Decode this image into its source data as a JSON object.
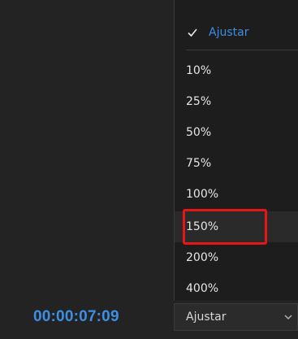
{
  "menu": {
    "selected": "Ajustar",
    "items": [
      "10%",
      "25%",
      "50%",
      "75%",
      "100%",
      "150%",
      "200%",
      "400%"
    ],
    "highlighted_item": "150%"
  },
  "footer": {
    "timecode": "00:00:07:09",
    "zoom_select_value": "Ajustar"
  },
  "colors": {
    "accent": "#3d8ee6",
    "highlight_border": "#e61616",
    "background": "#232323"
  },
  "icons": {
    "check": "check-icon",
    "chevron": "chevron-down-icon"
  }
}
